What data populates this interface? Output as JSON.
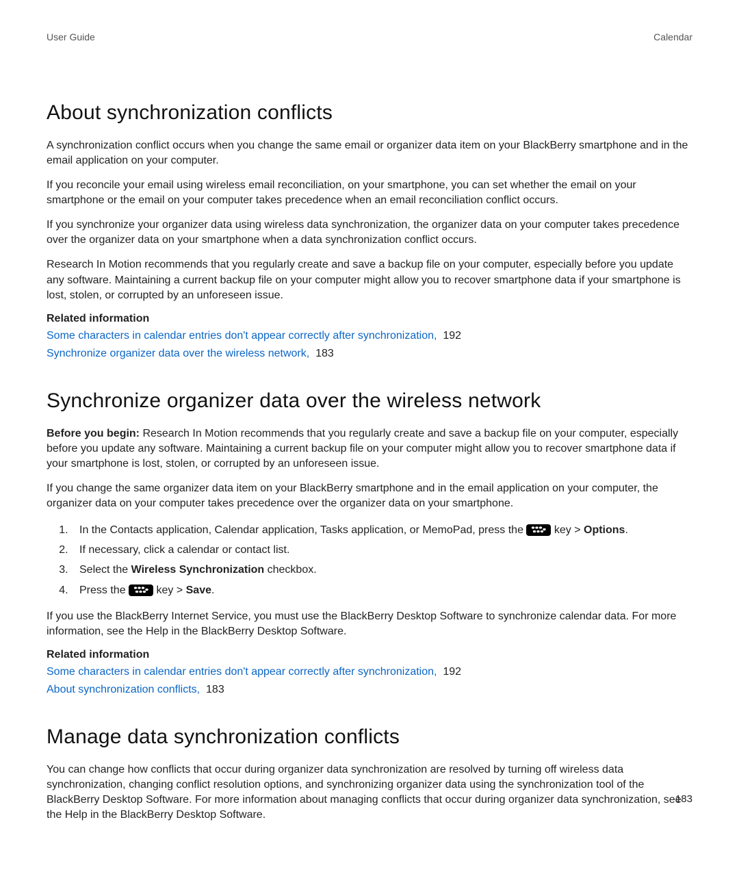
{
  "header": {
    "left": "User Guide",
    "right": "Calendar"
  },
  "sections": {
    "about": {
      "title": "About synchronization conflicts",
      "p1": "A synchronization conflict occurs when you change the same email or organizer data item on your BlackBerry smartphone and in the email application on your computer.",
      "p2": "If you reconcile your email using wireless email reconciliation, on your smartphone, you can set whether the email on your smartphone or the email on your computer takes precedence when an email reconciliation conflict occurs.",
      "p3": "If you synchronize your organizer data using wireless data synchronization, the organizer data on your computer takes precedence over the organizer data on your smartphone when a data synchronization conflict occurs.",
      "p4": "Research In Motion recommends that you regularly create and save a backup file on your computer, especially before you update any software. Maintaining a current backup file on your computer might allow you to recover smartphone data if your smartphone is lost, stolen, or corrupted by an unforeseen issue.",
      "related_heading": "Related information",
      "related": [
        {
          "text": "Some characters in calendar entries don't appear correctly after synchronization,",
          "page": "192"
        },
        {
          "text": "Synchronize organizer data over the wireless network,",
          "page": "183"
        }
      ]
    },
    "sync": {
      "title": "Synchronize organizer data over the wireless network",
      "before_label": "Before you begin: ",
      "before_text": "Research In Motion recommends that you regularly create and save a backup file on your computer, especially before you update any software. Maintaining a current backup file on your computer might allow you to recover smartphone data if your smartphone is lost, stolen, or corrupted by an unforeseen issue.",
      "p2": "If you change the same organizer data item on your BlackBerry smartphone and in the email application on your computer, the organizer data on your computer takes precedence over the organizer data on your smartphone.",
      "steps": {
        "s1a": "In the Contacts application, Calendar application, Tasks application, or MemoPad, press the ",
        "s1b": " key > ",
        "s1c": "Options",
        "s1d": ".",
        "s2": "If necessary, click a calendar or contact list.",
        "s3a": "Select the ",
        "s3b": "Wireless Synchronization",
        "s3c": " checkbox.",
        "s4a": "Press the ",
        "s4b": " key > ",
        "s4c": "Save",
        "s4d": "."
      },
      "p_after": "If you use the BlackBerry Internet Service, you must use the BlackBerry Desktop Software to synchronize calendar data. For more information, see the Help in the BlackBerry Desktop Software.",
      "related_heading": "Related information",
      "related": [
        {
          "text": "Some characters in calendar entries don't appear correctly after synchronization,",
          "page": "192"
        },
        {
          "text": "About synchronization conflicts,",
          "page": "183"
        }
      ]
    },
    "manage": {
      "title": "Manage data synchronization conflicts",
      "p1": "You can change how conflicts that occur during organizer data synchronization are resolved by turning off wireless data synchronization, changing conflict resolution options, and synchronizing organizer data using the synchronization tool of the BlackBerry Desktop Software. For more information about managing conflicts that occur during organizer data synchronization, see the Help in the BlackBerry Desktop Software."
    }
  },
  "page_number": "183"
}
